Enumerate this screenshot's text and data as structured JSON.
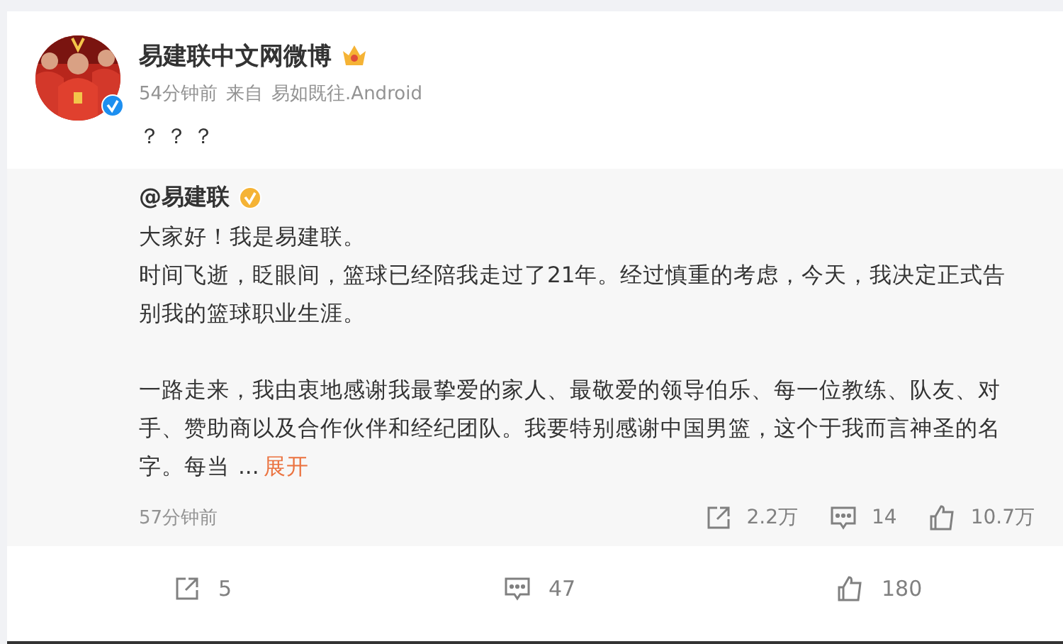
{
  "post": {
    "author": "易建联中文网微博",
    "author_verified": true,
    "author_member": true,
    "time": "54分钟前",
    "source_prefix": "来自",
    "source": "易如既往.Android",
    "text": "？？？"
  },
  "quoted": {
    "author": "@易建联",
    "author_verified": true,
    "sections": [
      [
        "大家好！我是易建联。",
        "时间飞逝，眨眼间，篮球已经陪我走过了21年。经过慎重的考虑，今天，我决定正式告别我的篮球职业生涯。"
      ],
      [
        "一路走来，我由衷地感谢我最挚爱的家人、最敬爱的领导伯乐、每一位教练、队友、对手、赞助商以及合作伙伴和经纪团队。我要特别感谢中国男篮，这个于我而言神圣的名字。每当"
      ]
    ],
    "ellipsis": "...",
    "expand_link": "展开",
    "time": "57分钟前",
    "actions": [
      {
        "kind": "repost",
        "count": "2.2万"
      },
      {
        "kind": "comment",
        "count": "14"
      },
      {
        "kind": "like",
        "count": "10.7万"
      }
    ]
  },
  "actions": [
    {
      "kind": "repost",
      "count": "5"
    },
    {
      "kind": "comment",
      "count": "47"
    },
    {
      "kind": "like",
      "count": "180"
    }
  ]
}
